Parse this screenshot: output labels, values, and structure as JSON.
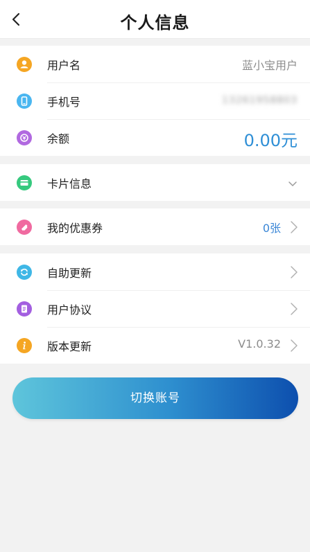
{
  "header": {
    "title": "个人信息",
    "back_icon": "chevron-left-icon"
  },
  "profile": {
    "username": {
      "label": "用户名",
      "value": "蓝小宝用户",
      "icon": "user-icon",
      "icon_color": "#f5a623"
    },
    "phone": {
      "label": "手机号",
      "value": "13261958803",
      "icon": "phone-icon",
      "icon_color": "#4ab6f0"
    },
    "balance": {
      "label": "余额",
      "value": "0.00元",
      "icon": "wallet-icon",
      "icon_color": "#b169e0"
    }
  },
  "card": {
    "label": "卡片信息",
    "icon": "card-icon",
    "icon_color": "#36c97e",
    "expand_icon": "chevron-down-icon"
  },
  "coupon": {
    "label": "我的优惠券",
    "value": "0张",
    "icon": "ticket-icon",
    "icon_color": "#f06aa0"
  },
  "settings": {
    "self_update": {
      "label": "自助更新",
      "icon": "refresh-icon",
      "icon_color": "#3fb7e6"
    },
    "agreement": {
      "label": "用户协议",
      "icon": "document-icon",
      "icon_color": "#a35fe0"
    },
    "version": {
      "label": "版本更新",
      "value": "V1.0.32",
      "icon": "info-icon",
      "icon_color": "#f5a623"
    }
  },
  "actions": {
    "switch_account": "切换账号"
  },
  "colors": {
    "accent": "#2f8fd6",
    "button_start": "#5ec5db",
    "button_end": "#0d4fae"
  }
}
